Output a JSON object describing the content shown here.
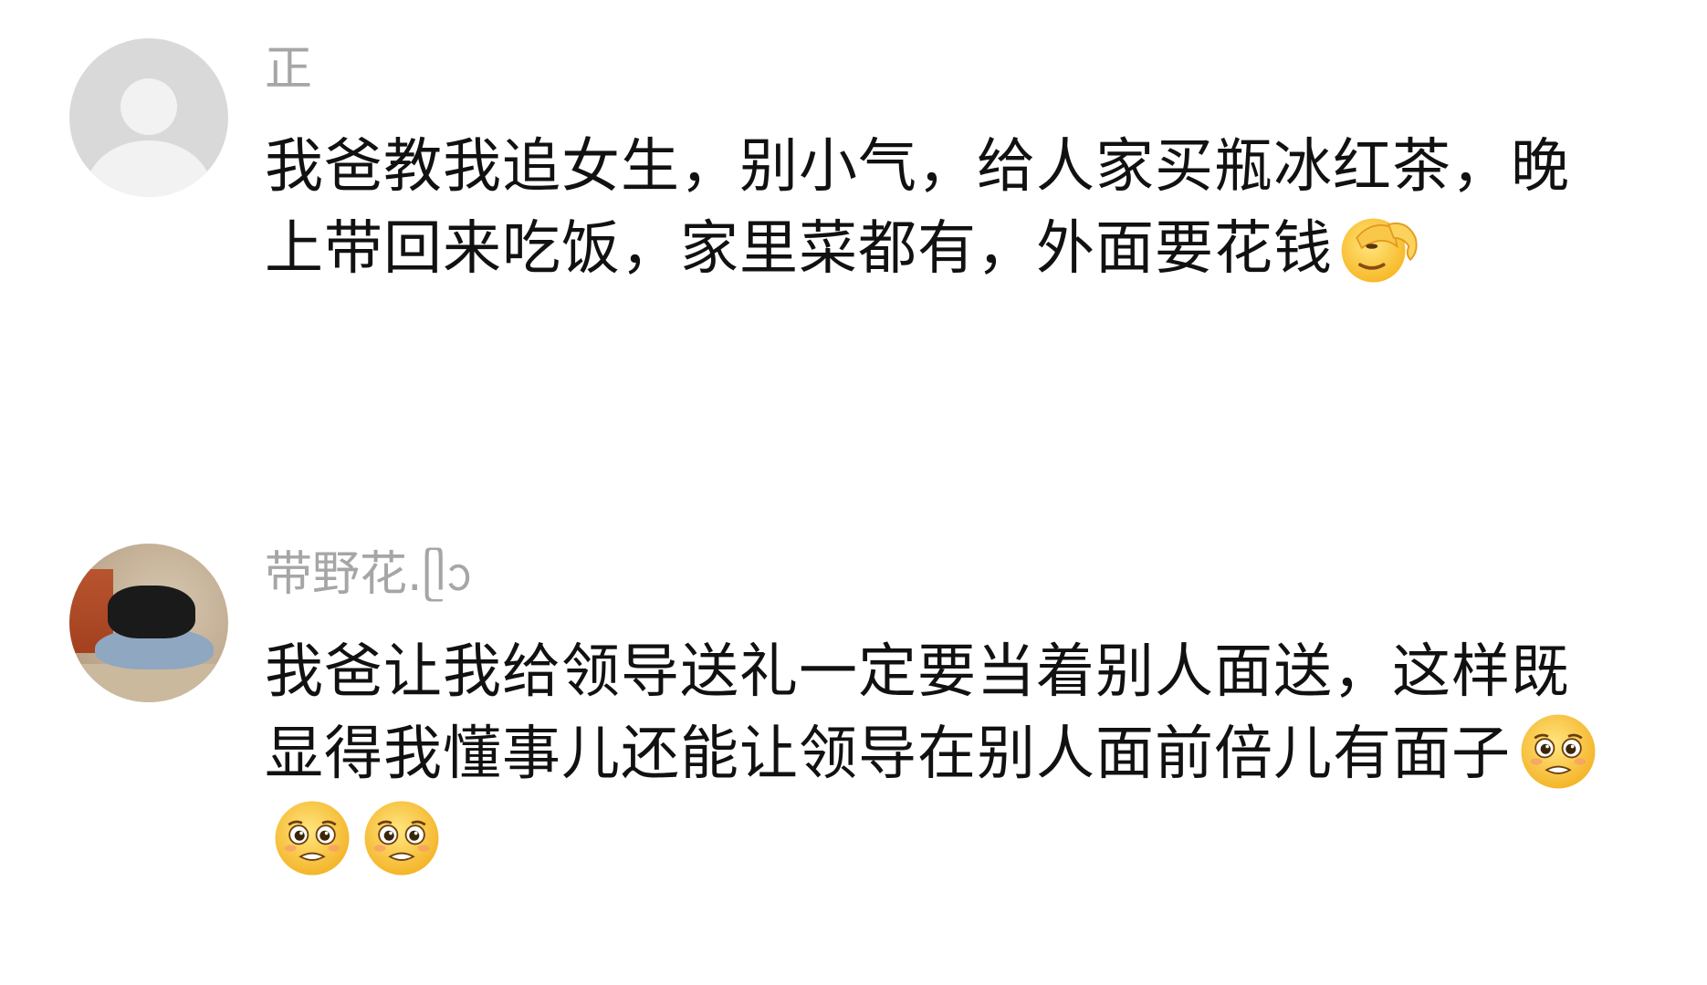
{
  "comments": [
    {
      "username": "正",
      "avatar": "default-person-avatar",
      "text": "我爸教我追女生，别小气，给人家买瓶冰红茶，晚上带回来吃饭，家里菜都有，外面要花钱",
      "emojis": [
        "facepalm-emoji"
      ]
    },
    {
      "username": "带野花.ᥫᩣ",
      "avatar": "cat-photo-avatar",
      "text": "我爸让我给领导送礼一定要当着别人面送，这样既显得我懂事儿还能让领导在别人面前倍儿有面子",
      "emojis": [
        "pleading-emoji",
        "pleading-emoji",
        "pleading-emoji"
      ]
    }
  ]
}
